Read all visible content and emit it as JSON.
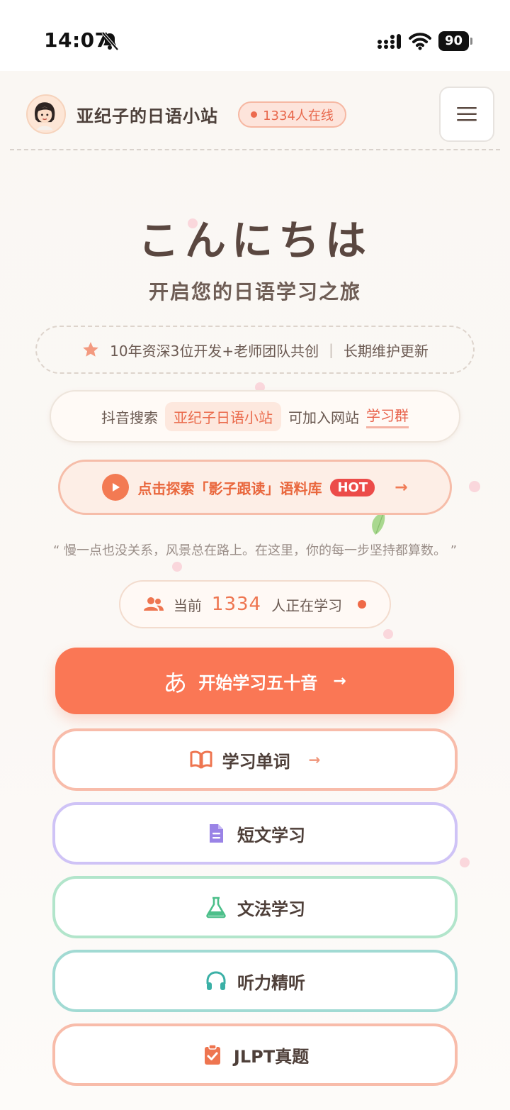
{
  "status_bar": {
    "time": "14:07",
    "battery": "90"
  },
  "header": {
    "site_title": "亚纪子的日语小站",
    "online_badge": "1334人在线"
  },
  "hero": {
    "title": "こんにちは",
    "subtitle": "开启您的日语学习之旅"
  },
  "team_banner": {
    "left": "10年资深3位开发+老师团队共创",
    "separator": "|",
    "right": "长期维护更新"
  },
  "douyin": {
    "prefix": "抖音搜索",
    "account": "亚纪子日语小站",
    "middle": "可加入网站",
    "link": "学习群"
  },
  "shadow_reading": {
    "label": "点击探索「影子跟读」语料库",
    "badge": "HOT",
    "arrow": "→"
  },
  "quote": "“ 慢一点也没关系，风景总在路上。在这里，你的每一步坚持都算数。 ”",
  "learning_now": {
    "prefix": "当前",
    "count": "1334",
    "suffix": "人正在学习"
  },
  "start_button": {
    "glyph": "あ",
    "label": "开始学习五十音",
    "arrow": "→"
  },
  "nav": [
    {
      "label": "学习单词",
      "icon": "book-icon",
      "arrow": "→"
    },
    {
      "label": "短文学习",
      "icon": "document-icon"
    },
    {
      "label": "文法学习",
      "icon": "flask-icon"
    },
    {
      "label": "听力精听",
      "icon": "headphones-icon"
    },
    {
      "label": "JLPT真题",
      "icon": "clipboard-check-icon"
    }
  ],
  "colors": {
    "accent": "#fa7755",
    "vocab_border": "#f8bcaa",
    "reading_border": "#cfc3f6",
    "grammar_border": "#b2e5cb",
    "listening_border": "#a1dad3",
    "hot_badge": "#ec4b49"
  }
}
